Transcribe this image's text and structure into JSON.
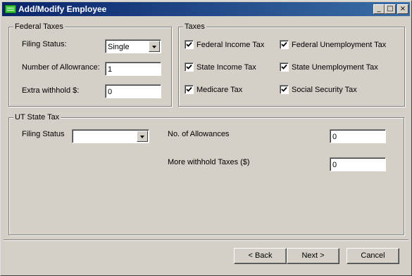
{
  "window": {
    "title": "Add/Modify Employee",
    "minimize": "_",
    "maximize": "□",
    "close": "×"
  },
  "federal": {
    "legend": "Federal Taxes",
    "filing_status_label": "Filing Status:",
    "filing_status_value": "Single",
    "allowance_label": "Number of Allowrance:",
    "allowance_value": "1",
    "extra_label": "Extra withhold $:",
    "extra_value": "0"
  },
  "taxes": {
    "legend": "Taxes",
    "items": [
      {
        "label": "Federal Income Tax",
        "checked": true
      },
      {
        "label": "Federal Unemployment Tax",
        "checked": true
      },
      {
        "label": "State Income Tax",
        "checked": true
      },
      {
        "label": "State Unemployment Tax",
        "checked": true
      },
      {
        "label": "Medicare Tax",
        "checked": true
      },
      {
        "label": "Social Security Tax",
        "checked": true
      }
    ]
  },
  "state": {
    "legend": "UT State Tax",
    "filing_status_label": "Filing Status",
    "filing_status_value": "",
    "allowances_label": "No. of Allowances",
    "allowances_value": "0",
    "more_label": "More withhold Taxes ($)",
    "more_value": "0"
  },
  "buttons": {
    "back": "< Back",
    "next": "Next >",
    "cancel": "Cancel"
  }
}
